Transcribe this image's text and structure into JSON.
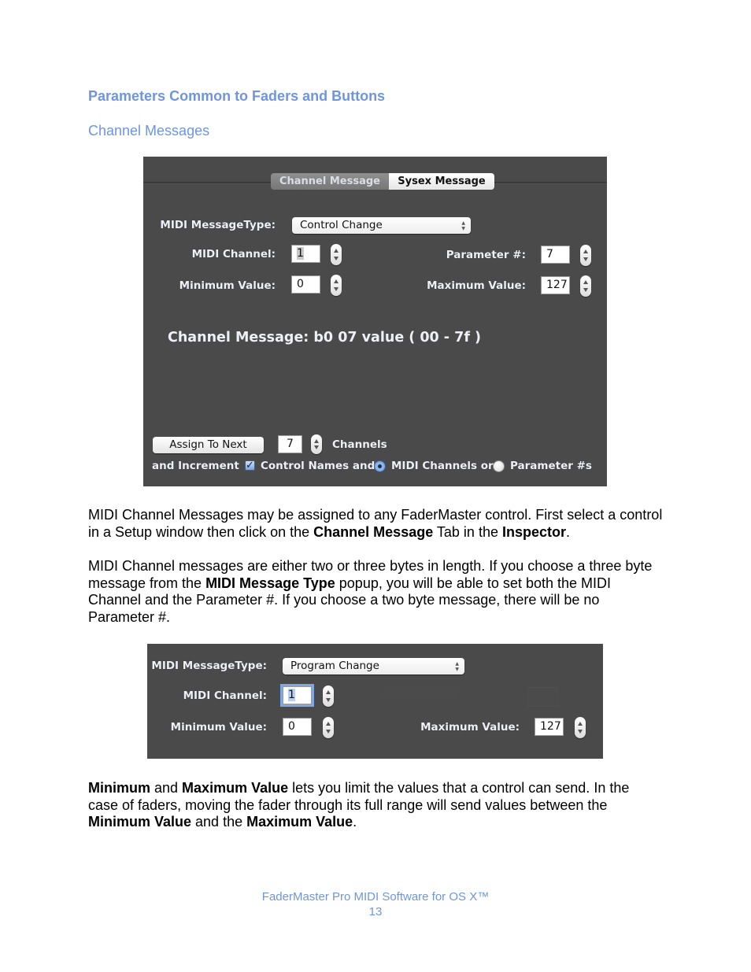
{
  "section_title": "Parameters Common to Faders and Buttons",
  "subsection_title": "Channel Messages",
  "panel1": {
    "tabs": [
      {
        "label": "Channel Message",
        "selected": true
      },
      {
        "label": "Sysex Message",
        "selected": false
      }
    ],
    "message_type_label": "MIDI MessageType:",
    "message_type_value": "Control Change",
    "midi_channel_label": "MIDI Channel:",
    "midi_channel_value": "1",
    "parameter_label": "Parameter #:",
    "parameter_value": "7",
    "min_label": "Minimum Value:",
    "min_value": "0",
    "max_label": "Maximum Value:",
    "max_value": "127",
    "channel_message_text": "Channel Message:  b0 07 value ( 00 - 7f )",
    "assign_button_label": "Assign To Next",
    "assign_count_value": "7",
    "channels_label": "Channels",
    "and_increment_label": "and Increment",
    "control_names_label": "Control Names and",
    "control_names_checked": true,
    "radio_midi_channels_label": "MIDI Channels or",
    "radio_midi_channels_selected": true,
    "radio_parameters_label": "Parameter #s",
    "radio_parameters_selected": false
  },
  "paragraph1": {
    "t1": "MIDI Channel Messages may be assigned to any FaderMaster control. First select a control in a Setup window then click on the ",
    "b1": "Channel Message",
    "t2": " Tab in the ",
    "b2": "Inspector",
    "t3": "."
  },
  "paragraph2": {
    "t1": "MIDI Channel messages are either two or three bytes in length. If you choose a three byte message from the ",
    "b1": "MIDI Message Type",
    "t2": " popup, you will be able to set both the MIDI Channel and the Parameter #. If you choose a two byte message, there will be no Parameter #."
  },
  "panel2": {
    "message_type_label": "MIDI MessageType:",
    "message_type_value": "Program Change",
    "midi_channel_label": "MIDI Channel:",
    "midi_channel_value": "1",
    "min_label": "Minimum Value:",
    "min_value": "0",
    "max_label": "Maximum Value:",
    "max_value": "127"
  },
  "paragraph3": {
    "b1": "Minimum",
    "t1": " and ",
    "b2": "Maximum Value",
    "t2": " lets you limit the values that a control can send. In the case of faders, moving the fader through its full range will send values between the ",
    "b3": "Minimum Value",
    "t3": " and the ",
    "b4": "Maximum Value",
    "t4": "."
  },
  "footer": {
    "title": "FaderMaster Pro MIDI Software for OS X™",
    "page_number": "13"
  }
}
